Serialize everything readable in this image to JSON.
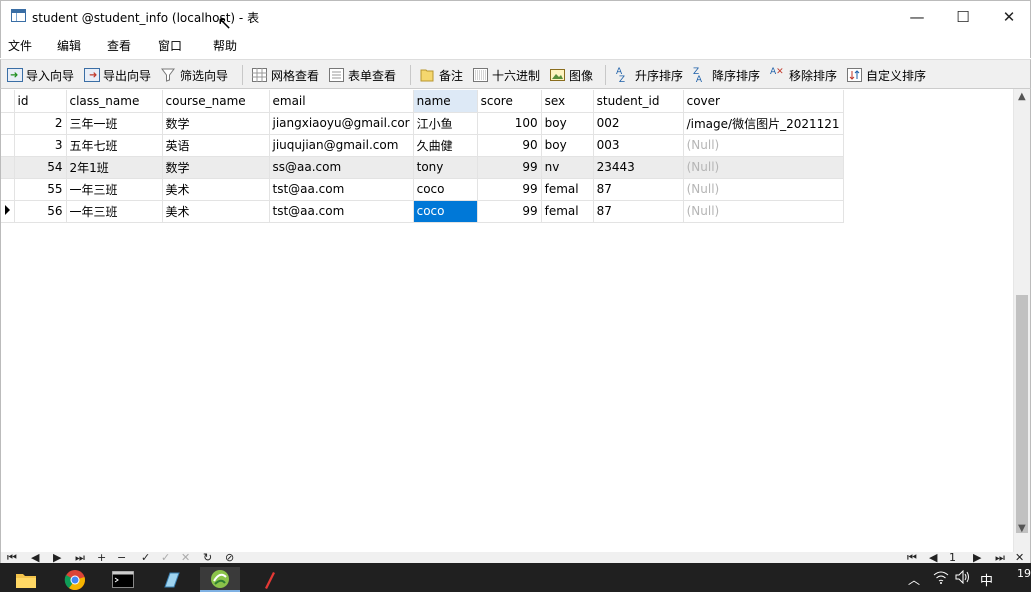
{
  "window": {
    "title": "student @student_info (localhost) - 表",
    "minimize_glyph": "—",
    "maximize_glyph": "☐",
    "close_glyph": "✕"
  },
  "menu": [
    "文件",
    "编辑",
    "查看",
    "窗口",
    "帮助"
  ],
  "toolbar": {
    "import_wizard": "导入向导",
    "export_wizard": "导出向导",
    "filter_wizard": "筛选向导",
    "grid_view": "网格查看",
    "form_view": "表单查看",
    "memo": "备注",
    "hex": "十六进制",
    "image": "图像",
    "sort_asc": "升序排序",
    "sort_desc": "降序排序",
    "remove_sort": "移除排序",
    "custom_sort": "自定义排序"
  },
  "table": {
    "columns": [
      "id",
      "class_name",
      "course_name",
      "email",
      "name",
      "score",
      "sex",
      "student_id",
      "cover"
    ],
    "sorted_column": "name",
    "rows": [
      {
        "id": "2",
        "class_name": "三年一班",
        "course_name": "数学",
        "email": "jiangxiaoyu@gmail.cor",
        "name": "江小鱼",
        "score": "100",
        "sex": "boy",
        "student_id": "002",
        "cover": "/image/微信图片_2021121"
      },
      {
        "id": "3",
        "class_name": "五年七班",
        "course_name": "英语",
        "email": "jiuqujian@gmail.com",
        "name": "久曲健",
        "score": "90",
        "sex": "boy",
        "student_id": "003",
        "cover": "(Null)"
      },
      {
        "id": "54",
        "class_name": "2年1班",
        "course_name": "数学",
        "email": "ss@aa.com",
        "name": "tony",
        "score": "99",
        "sex": "nv",
        "student_id": "23443",
        "cover": "(Null)"
      },
      {
        "id": "55",
        "class_name": "一年三班",
        "course_name": "美术",
        "email": "tst@aa.com",
        "name": "coco",
        "score": "99",
        "sex": "femal",
        "student_id": "87",
        "cover": "(Null)"
      },
      {
        "id": "56",
        "class_name": "一年三班",
        "course_name": "美术",
        "email": "tst@aa.com",
        "name": "coco",
        "score": "99",
        "sex": "femal",
        "student_id": "87",
        "cover": "(Null)"
      }
    ]
  },
  "status": {
    "page_number": "1"
  },
  "taskbar": {
    "ime": "中",
    "clock_partial": "19"
  },
  "colors": {
    "selection": "#0078d7",
    "sorted_header": "#dde9f6",
    "null_text": "#b5b5b5",
    "taskbar": "#202020"
  }
}
